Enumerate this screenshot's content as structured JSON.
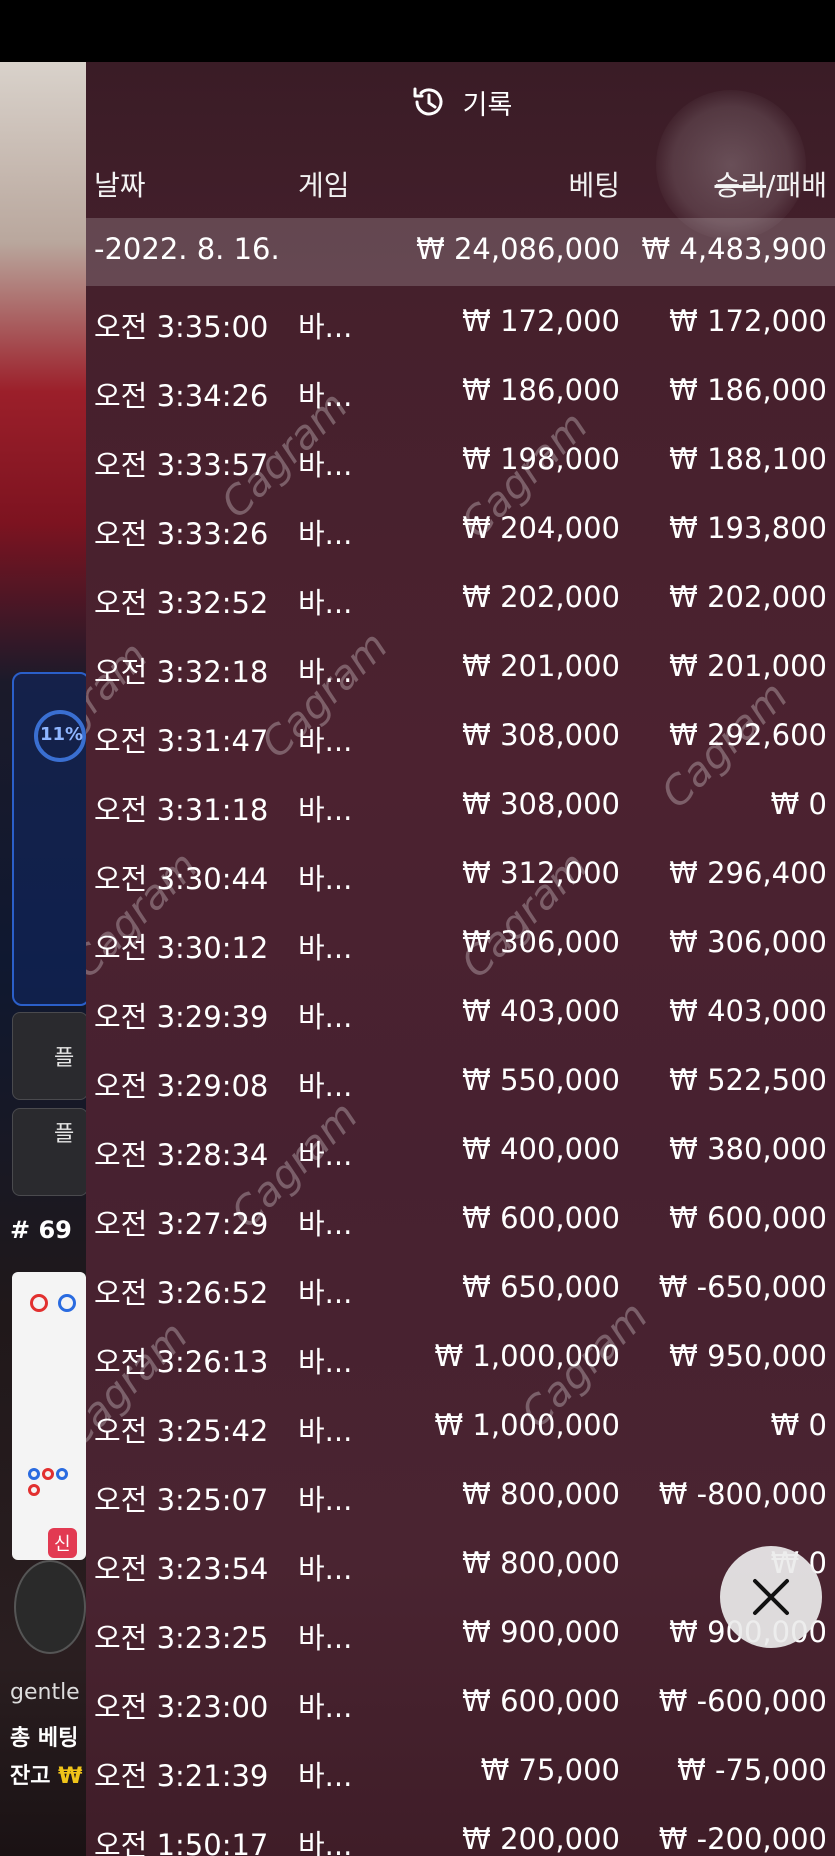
{
  "panel": {
    "title": "기록",
    "icon": "history-icon"
  },
  "columns": {
    "date": "날짜",
    "game": "게임",
    "bet": "베팅",
    "win": "승리",
    "win_suffix": "/패배"
  },
  "summary": {
    "date": "-2022. 8. 16.",
    "bet": "₩ 24,086,000",
    "win": "₩ 4,483,900"
  },
  "rows": [
    {
      "time": "오전 3:35:00",
      "game": "바...",
      "bet": "₩ 172,000",
      "win": "₩ 172,000"
    },
    {
      "time": "오전 3:34:26",
      "game": "바...",
      "bet": "₩ 186,000",
      "win": "₩ 186,000"
    },
    {
      "time": "오전 3:33:57",
      "game": "바...",
      "bet": "₩ 198,000",
      "win": "₩ 188,100"
    },
    {
      "time": "오전 3:33:26",
      "game": "바...",
      "bet": "₩ 204,000",
      "win": "₩ 193,800"
    },
    {
      "time": "오전 3:32:52",
      "game": "바...",
      "bet": "₩ 202,000",
      "win": "₩ 202,000"
    },
    {
      "time": "오전 3:32:18",
      "game": "바...",
      "bet": "₩ 201,000",
      "win": "₩ 201,000"
    },
    {
      "time": "오전 3:31:47",
      "game": "바...",
      "bet": "₩ 308,000",
      "win": "₩ 292,600"
    },
    {
      "time": "오전 3:31:18",
      "game": "바...",
      "bet": "₩ 308,000",
      "win": "₩ 0"
    },
    {
      "time": "오전 3:30:44",
      "game": "바...",
      "bet": "₩ 312,000",
      "win": "₩ 296,400"
    },
    {
      "time": "오전 3:30:12",
      "game": "바...",
      "bet": "₩ 306,000",
      "win": "₩ 306,000"
    },
    {
      "time": "오전 3:29:39",
      "game": "바...",
      "bet": "₩ 403,000",
      "win": "₩ 403,000"
    },
    {
      "time": "오전 3:29:08",
      "game": "바...",
      "bet": "₩ 550,000",
      "win": "₩ 522,500"
    },
    {
      "time": "오전 3:28:34",
      "game": "바...",
      "bet": "₩ 400,000",
      "win": "₩ 380,000"
    },
    {
      "time": "오전 3:27:29",
      "game": "바...",
      "bet": "₩ 600,000",
      "win": "₩ 600,000"
    },
    {
      "time": "오전 3:26:52",
      "game": "바...",
      "bet": "₩ 650,000",
      "win": "₩ -650,000"
    },
    {
      "time": "오전 3:26:13",
      "game": "바...",
      "bet": "₩ 1,000,000",
      "win": "₩ 950,000"
    },
    {
      "time": "오전 3:25:42",
      "game": "바...",
      "bet": "₩ 1,000,000",
      "win": "₩ 0"
    },
    {
      "time": "오전 3:25:07",
      "game": "바...",
      "bet": "₩ 800,000",
      "win": "₩ -800,000"
    },
    {
      "time": "오전 3:23:54",
      "game": "바...",
      "bet": "₩ 800,000",
      "win": "₩ 0"
    },
    {
      "time": "오전 3:23:25",
      "game": "바...",
      "bet": "₩ 900,000",
      "win": "₩ 900,000"
    },
    {
      "time": "오전 3:23:00",
      "game": "바...",
      "bet": "₩ 600,000",
      "win": "₩ -600,000"
    },
    {
      "time": "오전 3:21:39",
      "game": "바...",
      "bet": "₩ 75,000",
      "win": "₩ -75,000"
    },
    {
      "time": "오전 1:50:17",
      "game": "바...",
      "bet": "₩ 200,000",
      "win": "₩ -200,000"
    }
  ],
  "background": {
    "progress_label": "11%",
    "button1_label": "플",
    "button2_label": "플",
    "round_label": "# 69",
    "new_badge": "신",
    "username": "gentle",
    "total_bet_label": "총 베팅",
    "balance_label": "잔고",
    "balance_currency": "₩"
  },
  "watermark": "Cagram",
  "close_icon": "close-icon",
  "colors": {
    "panel_top": "#3a1c26",
    "panel_mid": "#4c2230",
    "text": "#ffffff",
    "summary_highlight": "rgba(255,255,255,0.18)",
    "close_button": "#ebebeb"
  }
}
